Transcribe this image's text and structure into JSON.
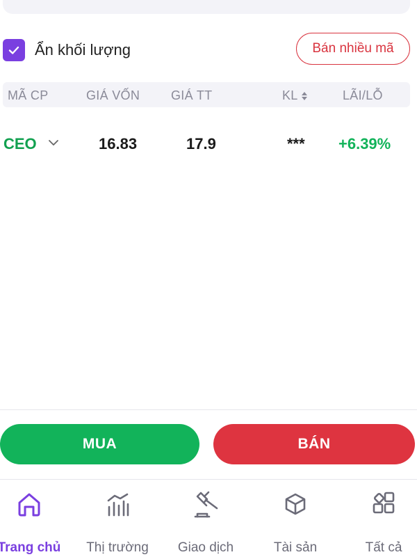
{
  "toolbar": {
    "hide_volume_label": "Ẩn khối lượng",
    "hide_volume_checked": true,
    "sell_multiple_label": "Bán nhiều mã"
  },
  "table": {
    "headers": {
      "symbol": "MÃ CP",
      "cost_price": "GIÁ VỐN",
      "market_price": "GIÁ TT",
      "volume": "KL",
      "profit_loss": "LÃI/LỖ"
    },
    "rows": [
      {
        "symbol": "CEO",
        "cost_price": "16.83",
        "market_price": "17.9",
        "volume": "***",
        "profit_loss": "+6.39%"
      }
    ]
  },
  "actions": {
    "buy_label": "MUA",
    "sell_label": "BÁN"
  },
  "bottom_nav": {
    "items": [
      {
        "label": "Trang chủ",
        "icon": "home-icon",
        "active": true
      },
      {
        "label": "Thị trường",
        "icon": "market-chart-icon",
        "active": false
      },
      {
        "label": "Giao dịch",
        "icon": "gavel-icon",
        "active": false
      },
      {
        "label": "Tài sản",
        "icon": "cube-icon",
        "active": false
      },
      {
        "label": "Tất cả",
        "icon": "grid-icon",
        "active": false
      }
    ]
  },
  "colors": {
    "accent": "#7a3fe0",
    "up": "#12b35a",
    "down": "#de3440",
    "symbol": "#12a150"
  }
}
